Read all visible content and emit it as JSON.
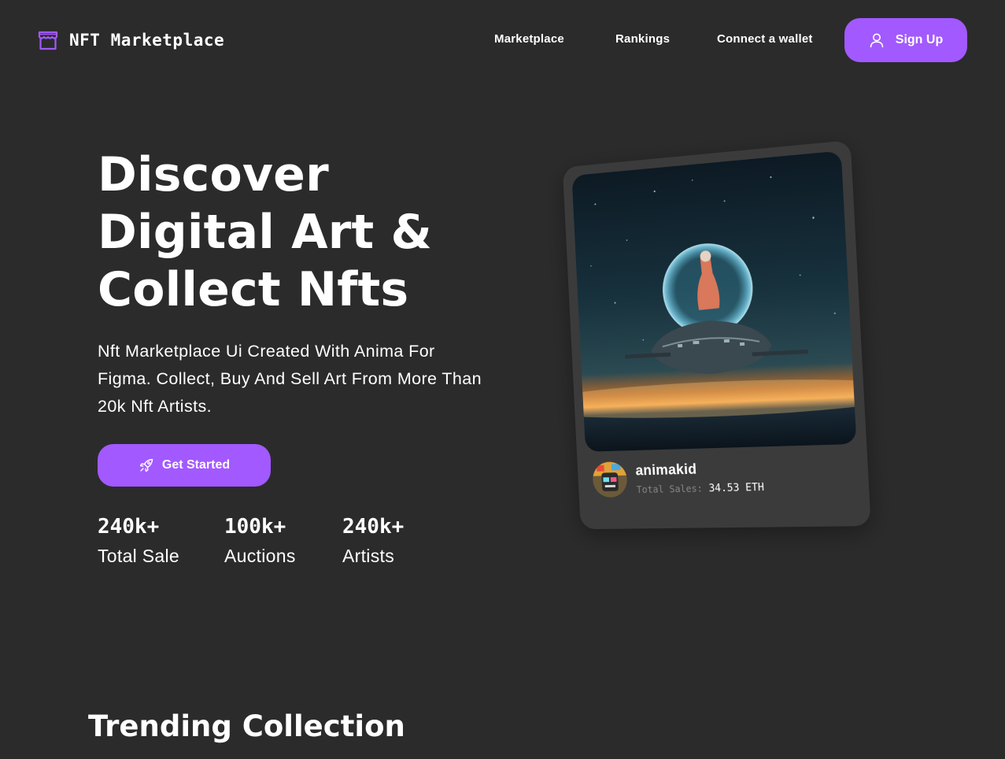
{
  "header": {
    "brand": "NFT Marketplace",
    "nav": [
      "Marketplace",
      "Rankings",
      "Connect a wallet"
    ],
    "signup_label": "Sign Up"
  },
  "hero": {
    "title_lines": [
      "Discover",
      "Digital Art &",
      "Collect Nfts"
    ],
    "subtitle": "Nft Marketplace Ui Created With Anima For Figma. Collect, Buy And Sell Art From More Than 20k Nft Artists.",
    "cta_label": "Get Started",
    "stats": [
      {
        "value": "240k+",
        "label": "Total Sale"
      },
      {
        "value": "100k+",
        "label": "Auctions"
      },
      {
        "value": "240k+",
        "label": "Artists"
      }
    ]
  },
  "featured_card": {
    "artist": "animakid",
    "sales_label": "Total Sales:",
    "sales_value": "34.53 ETH"
  },
  "sections": {
    "trending_title": "Trending Collection"
  },
  "colors": {
    "background": "#2b2b2b",
    "accent": "#a259ff",
    "card": "#3b3b3b",
    "muted": "#858584"
  },
  "icons": {
    "logo": "storefront-icon",
    "signup": "user-icon",
    "cta": "rocket-icon"
  }
}
